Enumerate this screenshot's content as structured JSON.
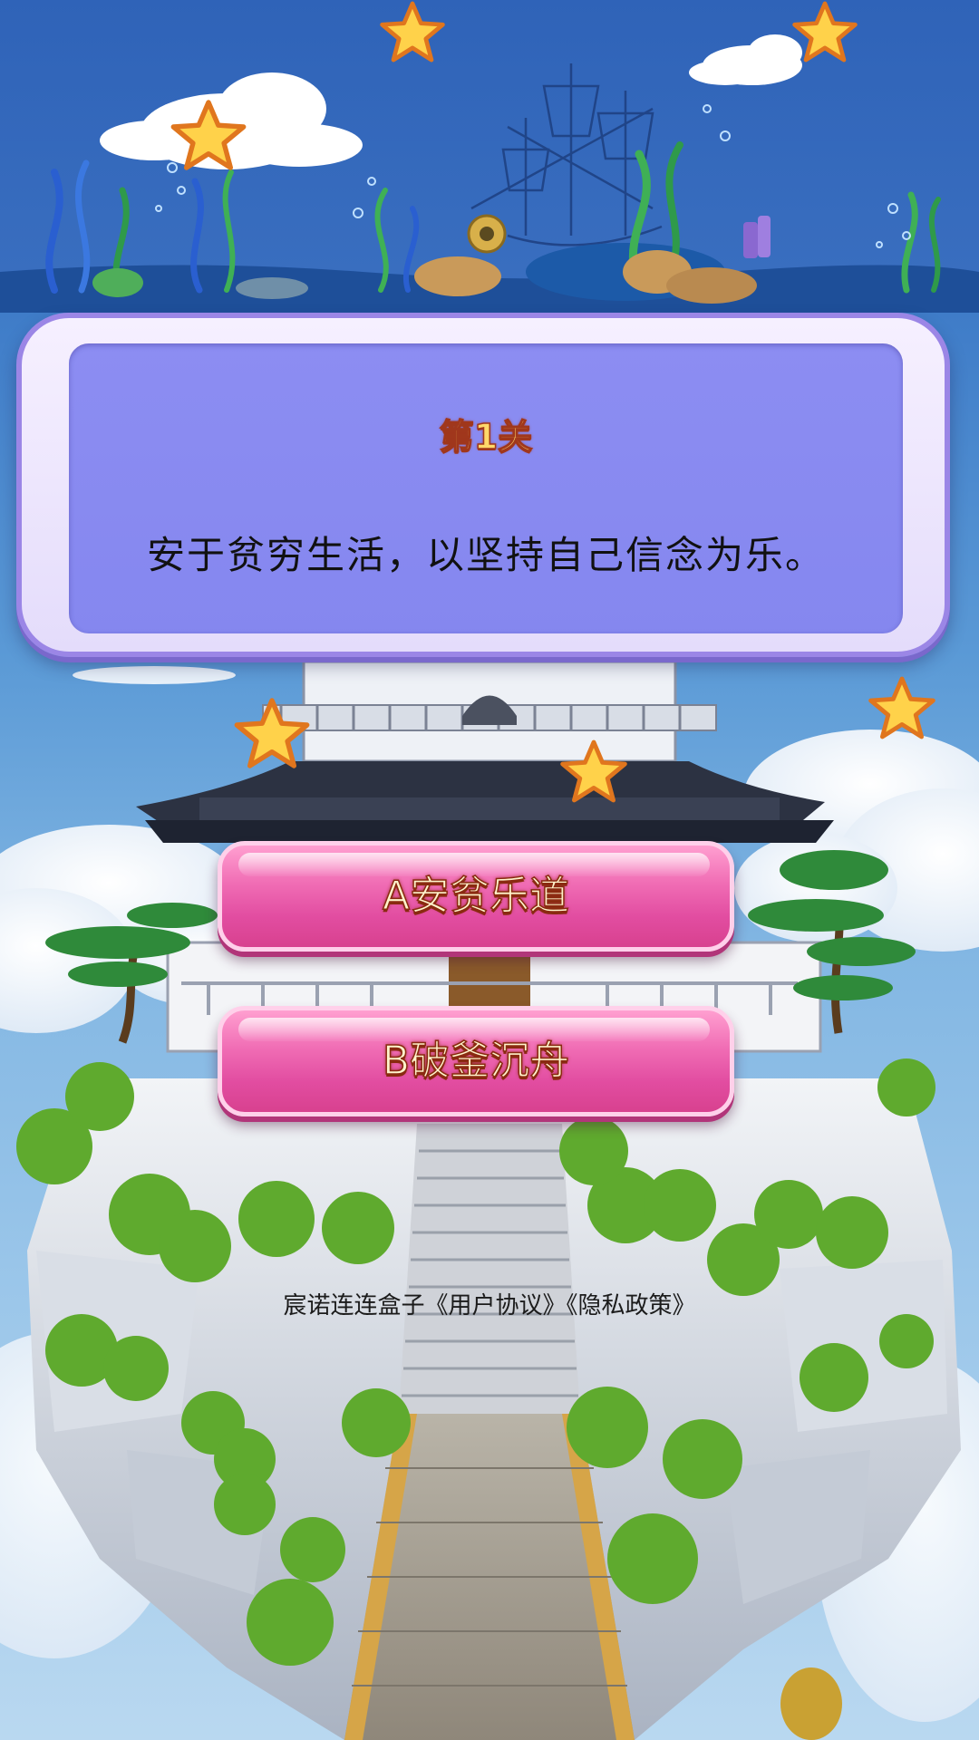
{
  "level": {
    "title": "第1关"
  },
  "question": {
    "text": "安于贫穷生活，以坚持自己信念为乐。"
  },
  "answers": [
    {
      "label": "A安贫乐道"
    },
    {
      "label": "B破釜沉舟"
    }
  ],
  "footer": {
    "app_name": "宸诺连连盒子",
    "user_agreement": "《用户协议》",
    "privacy_policy": "《隐私政策》"
  },
  "colors": {
    "panel_fill": "#8587ef",
    "panel_border": "#9b86e6",
    "button_pink": "#e24da1",
    "level_title": "#ffd86a"
  },
  "decor": {
    "stars": "star-icon",
    "ship": "ship-sketch-icon",
    "floating_island": "floating-island-illustration"
  }
}
